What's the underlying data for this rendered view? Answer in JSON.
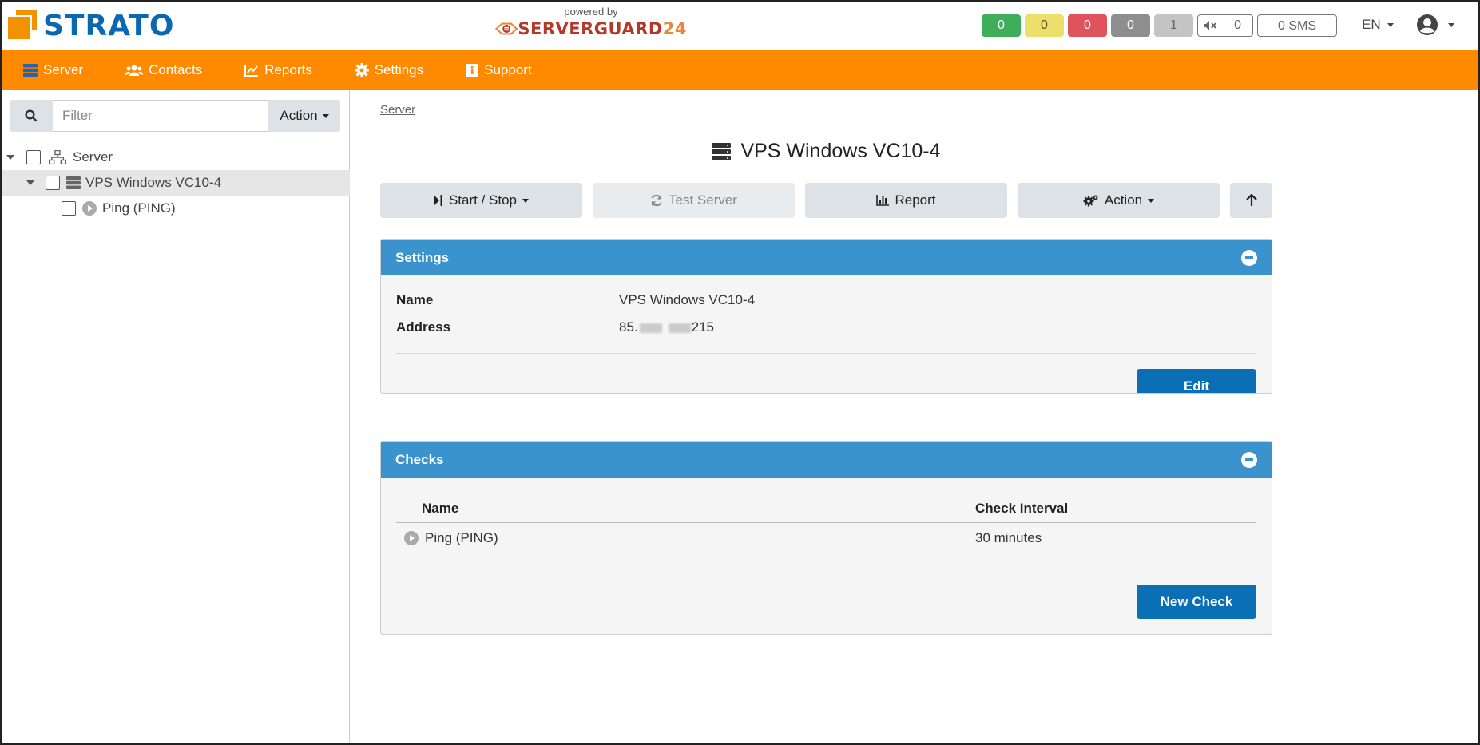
{
  "brand": {
    "name": "STRATO"
  },
  "powered_by": {
    "caption": "powered by",
    "product_main": "SERVERGUARD",
    "product_num": "24"
  },
  "counters": [
    {
      "value": "0",
      "color": "#3fae5b"
    },
    {
      "value": "0",
      "color": "#ece06a"
    },
    {
      "value": "0",
      "color": "#e0525e"
    },
    {
      "value": "0",
      "color": "#8e8e8e"
    },
    {
      "value": "1",
      "color": "#c4c4c4"
    }
  ],
  "mute_counter": {
    "value": "0",
    "icon": "speaker-mute-icon"
  },
  "sms_counter": "0 SMS",
  "language": "EN",
  "nav": {
    "items": [
      {
        "label": "Server",
        "icon": "server-icon"
      },
      {
        "label": "Contacts",
        "icon": "users-icon"
      },
      {
        "label": "Reports",
        "icon": "chart-line-icon"
      },
      {
        "label": "Settings",
        "icon": "gear-icon"
      },
      {
        "label": "Support",
        "icon": "info-icon"
      }
    ]
  },
  "sidebar": {
    "filter_placeholder": "Filter",
    "action_label": "Action",
    "tree": [
      {
        "label": "Server",
        "icon": "network-icon"
      },
      {
        "label": "VPS Windows VC10-4",
        "icon": "server-icon"
      },
      {
        "label": "Ping (PING)",
        "icon": "play-circle-icon"
      }
    ]
  },
  "main": {
    "breadcrumb": "Server",
    "title": "VPS Windows VC10-4",
    "toolbar": {
      "start_stop": "Start / Stop",
      "test_server": "Test Server",
      "report": "Report",
      "action": "Action"
    },
    "settings_panel": {
      "title": "Settings",
      "name_label": "Name",
      "name_value": "VPS Windows VC10-4",
      "address_label": "Address",
      "address_prefix": "85.",
      "address_suffix": "215",
      "edit_button": "Edit"
    },
    "checks_panel": {
      "title": "Checks",
      "columns": [
        "Name",
        "Check Interval"
      ],
      "rows": [
        {
          "name": "Ping (PING)",
          "interval": "30 minutes"
        }
      ],
      "new_button": "New Check"
    }
  }
}
